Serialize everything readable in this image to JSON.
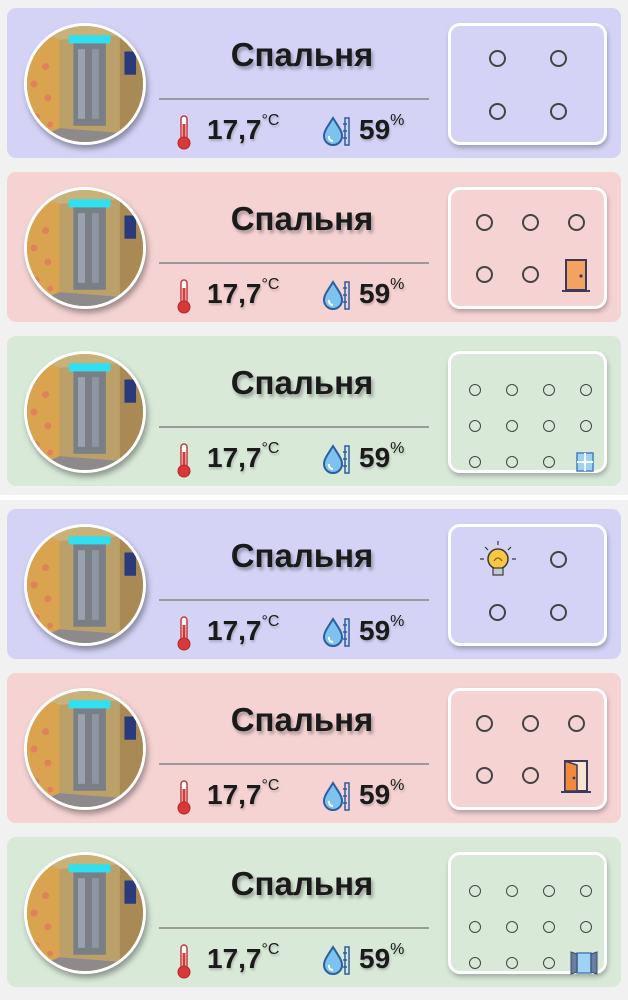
{
  "cards": [
    {
      "title": "Спальня",
      "temperature": "17,7",
      "temp_unit": "°C",
      "humidity": "59",
      "hum_unit": "%"
    },
    {
      "title": "Спальня",
      "temperature": "17,7",
      "temp_unit": "°C",
      "humidity": "59",
      "hum_unit": "%"
    },
    {
      "title": "Спальня",
      "temperature": "17,7",
      "temp_unit": "°C",
      "humidity": "59",
      "hum_unit": "%"
    },
    {
      "title": "Спальня",
      "temperature": "17,7",
      "temp_unit": "°C",
      "humidity": "59",
      "hum_unit": "%"
    },
    {
      "title": "Спальня",
      "temperature": "17,7",
      "temp_unit": "°C",
      "humidity": "59",
      "hum_unit": "%"
    },
    {
      "title": "Спальня",
      "temperature": "17,7",
      "temp_unit": "°C",
      "humidity": "59",
      "hum_unit": "%"
    }
  ],
  "colors": {
    "blue_card": "#d4d3f6",
    "pink_card": "#f5d3d3",
    "green_card": "#d8e9d8"
  },
  "icons": [
    "thermometer-icon",
    "humidity-icon",
    "door-closed-icon",
    "window-closed-icon",
    "lightbulb-on-icon",
    "door-open-icon",
    "window-open-icon"
  ]
}
